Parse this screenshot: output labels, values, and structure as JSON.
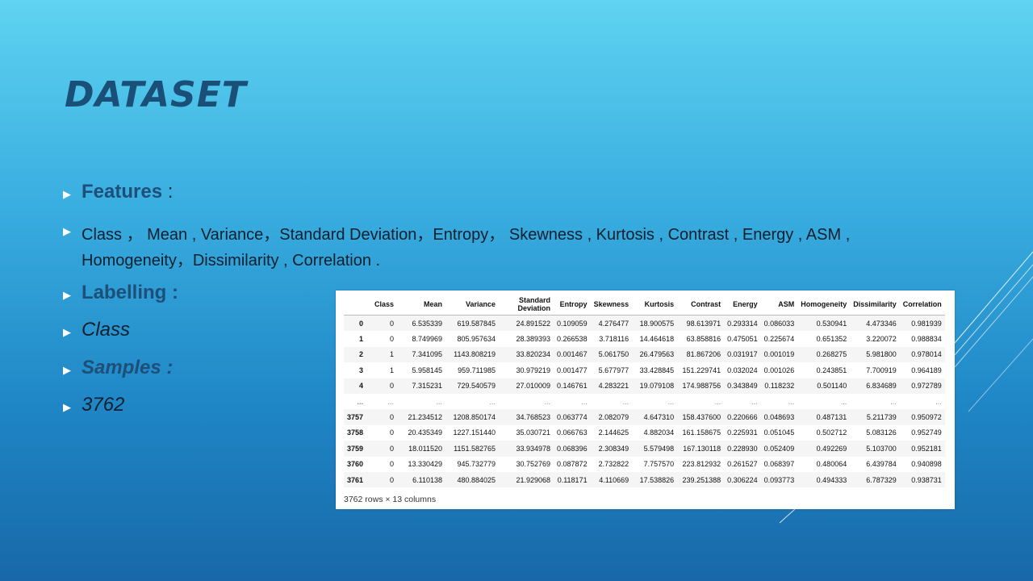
{
  "slide": {
    "title": "DATASET",
    "features_heading": "Features",
    "features_colon": ":",
    "features_line1": "Class ， Mean , Variance，Standard Deviation，Entropy， Skewness , Kurtosis , Contrast , Energy , ASM ,",
    "features_line2": "Homogeneity，Dissimilarity , Correlation .",
    "labelling_heading": "Labelling :",
    "labelling_value": "Class",
    "samples_heading": "Samples :",
    "samples_value": "3762"
  },
  "table": {
    "columns": [
      "",
      "Class",
      "Mean",
      "Variance",
      "Standard Deviation",
      "Entropy",
      "Skewness",
      "Kurtosis",
      "Contrast",
      "Energy",
      "ASM",
      "Homogeneity",
      "Dissimilarity",
      "Correlation"
    ],
    "rows": [
      [
        "0",
        "0",
        "6.535339",
        "619.587845",
        "24.891522",
        "0.109059",
        "4.276477",
        "18.900575",
        "98.613971",
        "0.293314",
        "0.086033",
        "0.530941",
        "4.473346",
        "0.981939"
      ],
      [
        "1",
        "0",
        "8.749969",
        "805.957634",
        "28.389393",
        "0.266538",
        "3.718116",
        "14.464618",
        "63.858816",
        "0.475051",
        "0.225674",
        "0.651352",
        "3.220072",
        "0.988834"
      ],
      [
        "2",
        "1",
        "7.341095",
        "1143.808219",
        "33.820234",
        "0.001467",
        "5.061750",
        "26.479563",
        "81.867206",
        "0.031917",
        "0.001019",
        "0.268275",
        "5.981800",
        "0.978014"
      ],
      [
        "3",
        "1",
        "5.958145",
        "959.711985",
        "30.979219",
        "0.001477",
        "5.677977",
        "33.428845",
        "151.229741",
        "0.032024",
        "0.001026",
        "0.243851",
        "7.700919",
        "0.964189"
      ],
      [
        "4",
        "0",
        "7.315231",
        "729.540579",
        "27.010009",
        "0.146761",
        "4.283221",
        "19.079108",
        "174.988756",
        "0.343849",
        "0.118232",
        "0.501140",
        "6.834689",
        "0.972789"
      ],
      [
        "...",
        "...",
        "...",
        "...",
        "...",
        "...",
        "...",
        "...",
        "...",
        "...",
        "...",
        "...",
        "...",
        "..."
      ],
      [
        "3757",
        "0",
        "21.234512",
        "1208.850174",
        "34.768523",
        "0.063774",
        "2.082079",
        "4.647310",
        "158.437600",
        "0.220666",
        "0.048693",
        "0.487131",
        "5.211739",
        "0.950972"
      ],
      [
        "3758",
        "0",
        "20.435349",
        "1227.151440",
        "35.030721",
        "0.066763",
        "2.144625",
        "4.882034",
        "161.158675",
        "0.225931",
        "0.051045",
        "0.502712",
        "5.083126",
        "0.952749"
      ],
      [
        "3759",
        "0",
        "18.011520",
        "1151.582765",
        "33.934978",
        "0.068396",
        "2.308349",
        "5.579498",
        "167.130118",
        "0.228930",
        "0.052409",
        "0.492269",
        "5.103700",
        "0.952181"
      ],
      [
        "3760",
        "0",
        "13.330429",
        "945.732779",
        "30.752769",
        "0.087872",
        "2.732822",
        "7.757570",
        "223.812932",
        "0.261527",
        "0.068397",
        "0.480064",
        "6.439784",
        "0.940898"
      ],
      [
        "3761",
        "0",
        "6.110138",
        "480.884025",
        "21.929068",
        "0.118171",
        "4.110669",
        "17.538826",
        "239.251388",
        "0.306224",
        "0.093773",
        "0.494333",
        "6.787329",
        "0.938731"
      ]
    ],
    "caption": "3762 rows × 13 columns"
  }
}
